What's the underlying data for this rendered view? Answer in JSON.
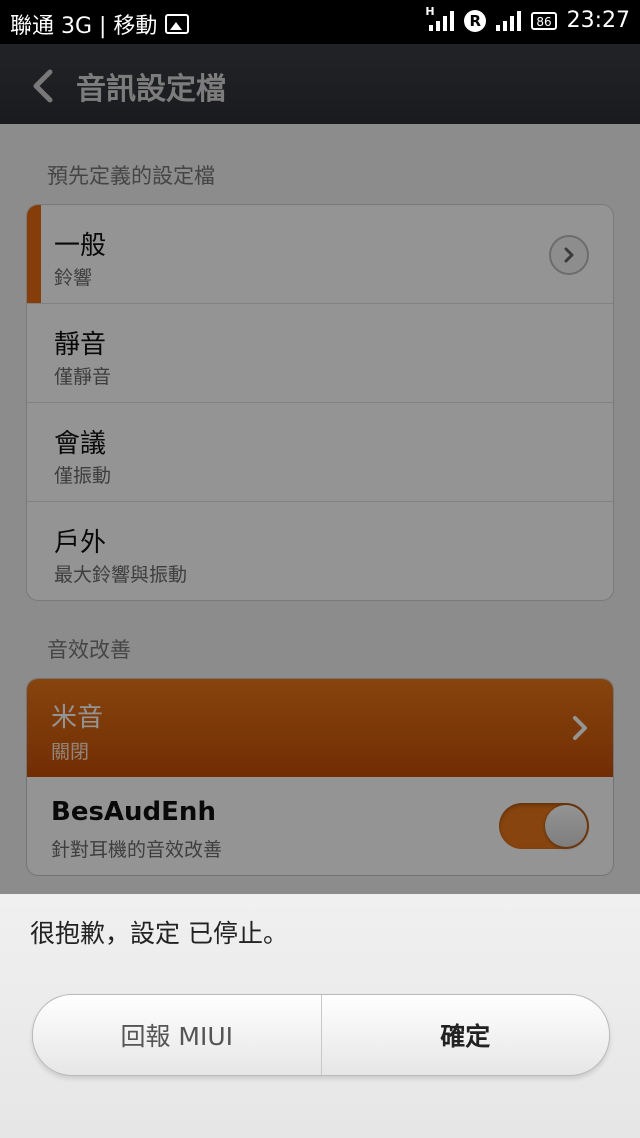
{
  "status_bar": {
    "carrier": "聯通 3G | 移動",
    "network_type": "H",
    "roaming": "R",
    "battery": "86",
    "time": "23:27"
  },
  "title_bar": {
    "title": "音訊設定檔",
    "back_icon": "chevron-left-icon"
  },
  "predefined_section": {
    "header": "預先定義的設定檔",
    "items": [
      {
        "title": "一般",
        "subtitle": "鈴響",
        "active": true
      },
      {
        "title": "靜音",
        "subtitle": "僅靜音"
      },
      {
        "title": "會議",
        "subtitle": "僅振動"
      },
      {
        "title": "戶外",
        "subtitle": "最大鈴響與振動"
      }
    ]
  },
  "sound_section": {
    "header": "音效改善",
    "items": [
      {
        "title": "米音",
        "subtitle": "關閉"
      },
      {
        "title": "BesAudEnh",
        "subtitle": "針對耳機的音效改善",
        "toggle_on": true
      }
    ]
  },
  "dialog": {
    "message": "很抱歉，設定 已停止。",
    "report_button": "回報 MIUI",
    "ok_button": "確定"
  },
  "colors": {
    "accent": "#e66a12",
    "title_bar": "#2f3237"
  }
}
